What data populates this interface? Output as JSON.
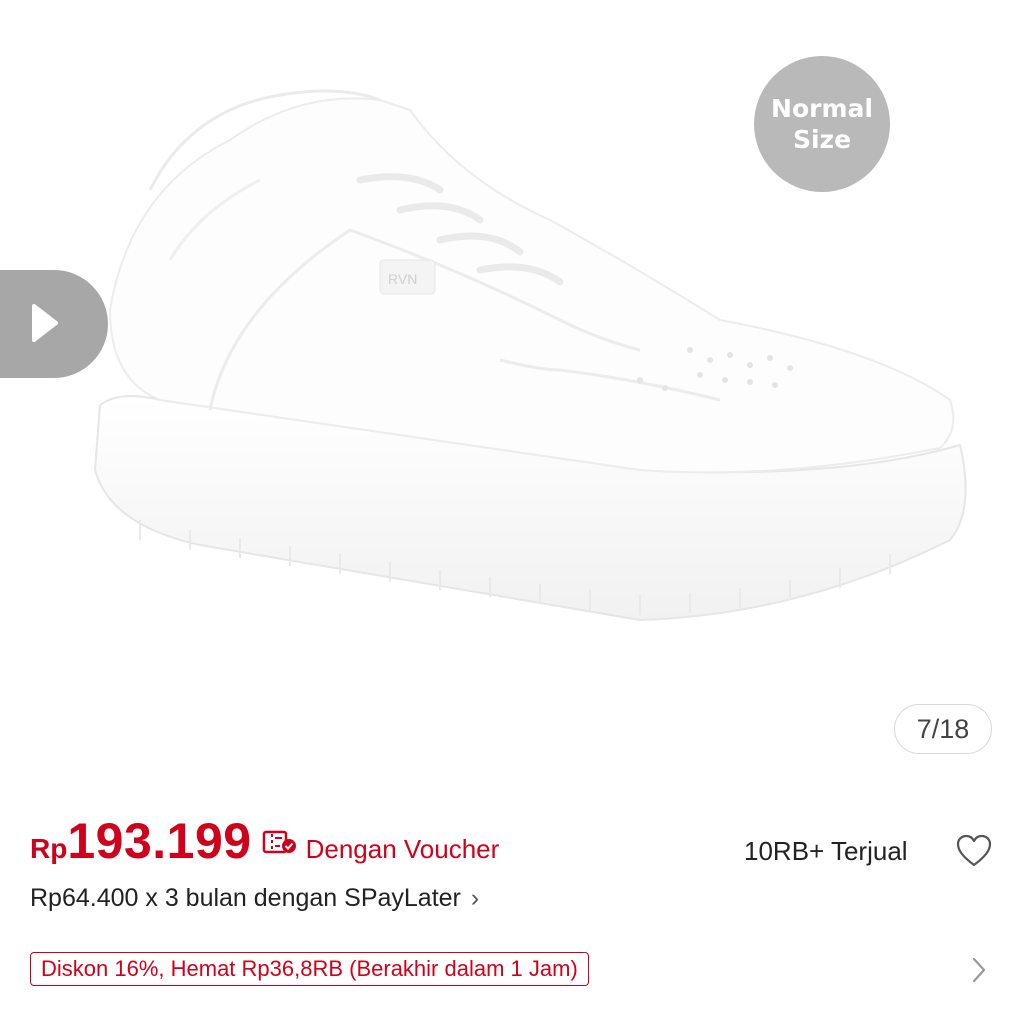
{
  "gallery": {
    "size_badge": {
      "line1": "Normal",
      "line2": "Size"
    },
    "counter": "7/18",
    "play_icon": "play-icon",
    "shoe_brand": "RVN"
  },
  "product": {
    "currency": "Rp",
    "price": "193.199",
    "voucher_icon": "voucher-check-icon",
    "voucher_label": "Dengan Voucher",
    "sold": "10RB+ Terjual",
    "favorite_icon": "heart-outline-icon",
    "paylater": "Rp64.400 x 3 bulan dengan SPayLater",
    "discount": "Diskon 16%, Hemat Rp36,8RB (Berakhir dalam 1 Jam)"
  },
  "colors": {
    "accent": "#d0011b",
    "badge_gray": "#b9b9b9",
    "play_gray": "#a7a7a7"
  }
}
